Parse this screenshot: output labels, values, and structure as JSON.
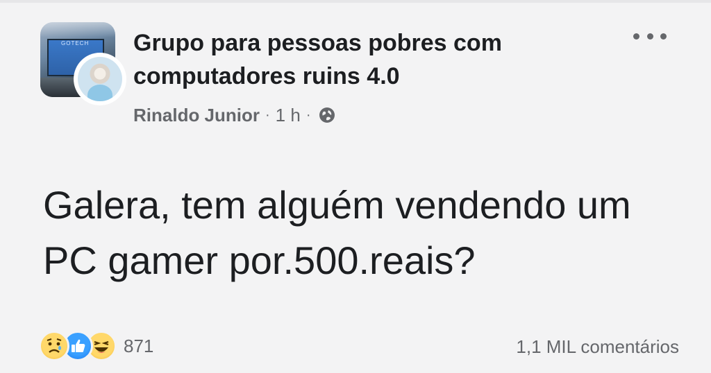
{
  "post": {
    "group_name": "Grupo para pessoas pobres com computadores ruins 4.0",
    "author": "Rinaldo Junior",
    "separator": "·",
    "time": "1 h",
    "privacy_icon": "globe-icon",
    "more_icon": "more-options-icon",
    "text": "Galera, tem alguém vendendo um PC gamer por.500.reais?",
    "group_avatar_caption": "GOTECH"
  },
  "reactions": {
    "icons": [
      "sad-icon",
      "like-icon",
      "haha-icon"
    ],
    "count": "871"
  },
  "comments": {
    "label": "1,1 MIL comentários"
  },
  "colors": {
    "background": "#f3f3f4",
    "primary_text": "#1c1e21",
    "secondary_text": "#65676b",
    "like_blue": "#1877f2",
    "emoji_yellow": "#ffd86a"
  }
}
